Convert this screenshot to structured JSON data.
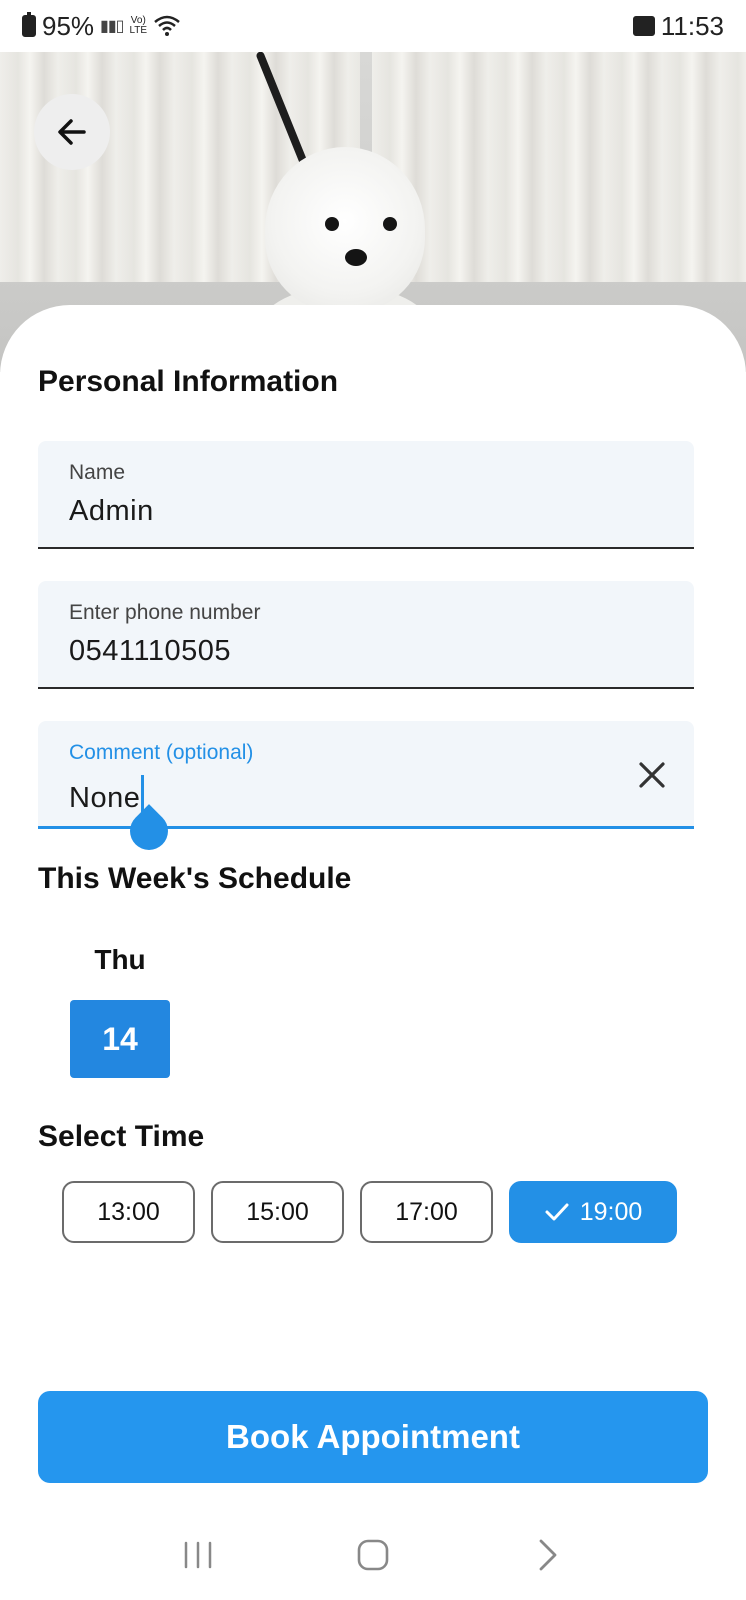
{
  "status_bar": {
    "battery": "95%",
    "time": "11:53",
    "icons": [
      "battery-charging-icon",
      "signal-icon",
      "volte-icon",
      "wifi-icon",
      "gallery-icon"
    ]
  },
  "hero": {
    "icon": "arrow-back-icon"
  },
  "personal": {
    "title": "Personal Information",
    "name_label": "Name",
    "name_value": "Admin",
    "phone_label": "Enter phone number",
    "phone_value": "0541110505",
    "comment_label": "Comment (optional)",
    "comment_value": "None"
  },
  "schedule": {
    "title": "This Week's Schedule",
    "day_name": "Thu",
    "day_number": "14"
  },
  "time": {
    "title": "Select Time",
    "slots": [
      "13:00",
      "15:00",
      "17:00",
      "19:00"
    ],
    "selected": "19:00"
  },
  "book_label": "Book Appointment",
  "colors": {
    "accent": "#2390e6",
    "field_bg": "#f2f6fa",
    "button": "#2596ee"
  },
  "nav": {
    "icons": [
      "recents-icon",
      "home-icon",
      "back-chevron-icon"
    ]
  }
}
